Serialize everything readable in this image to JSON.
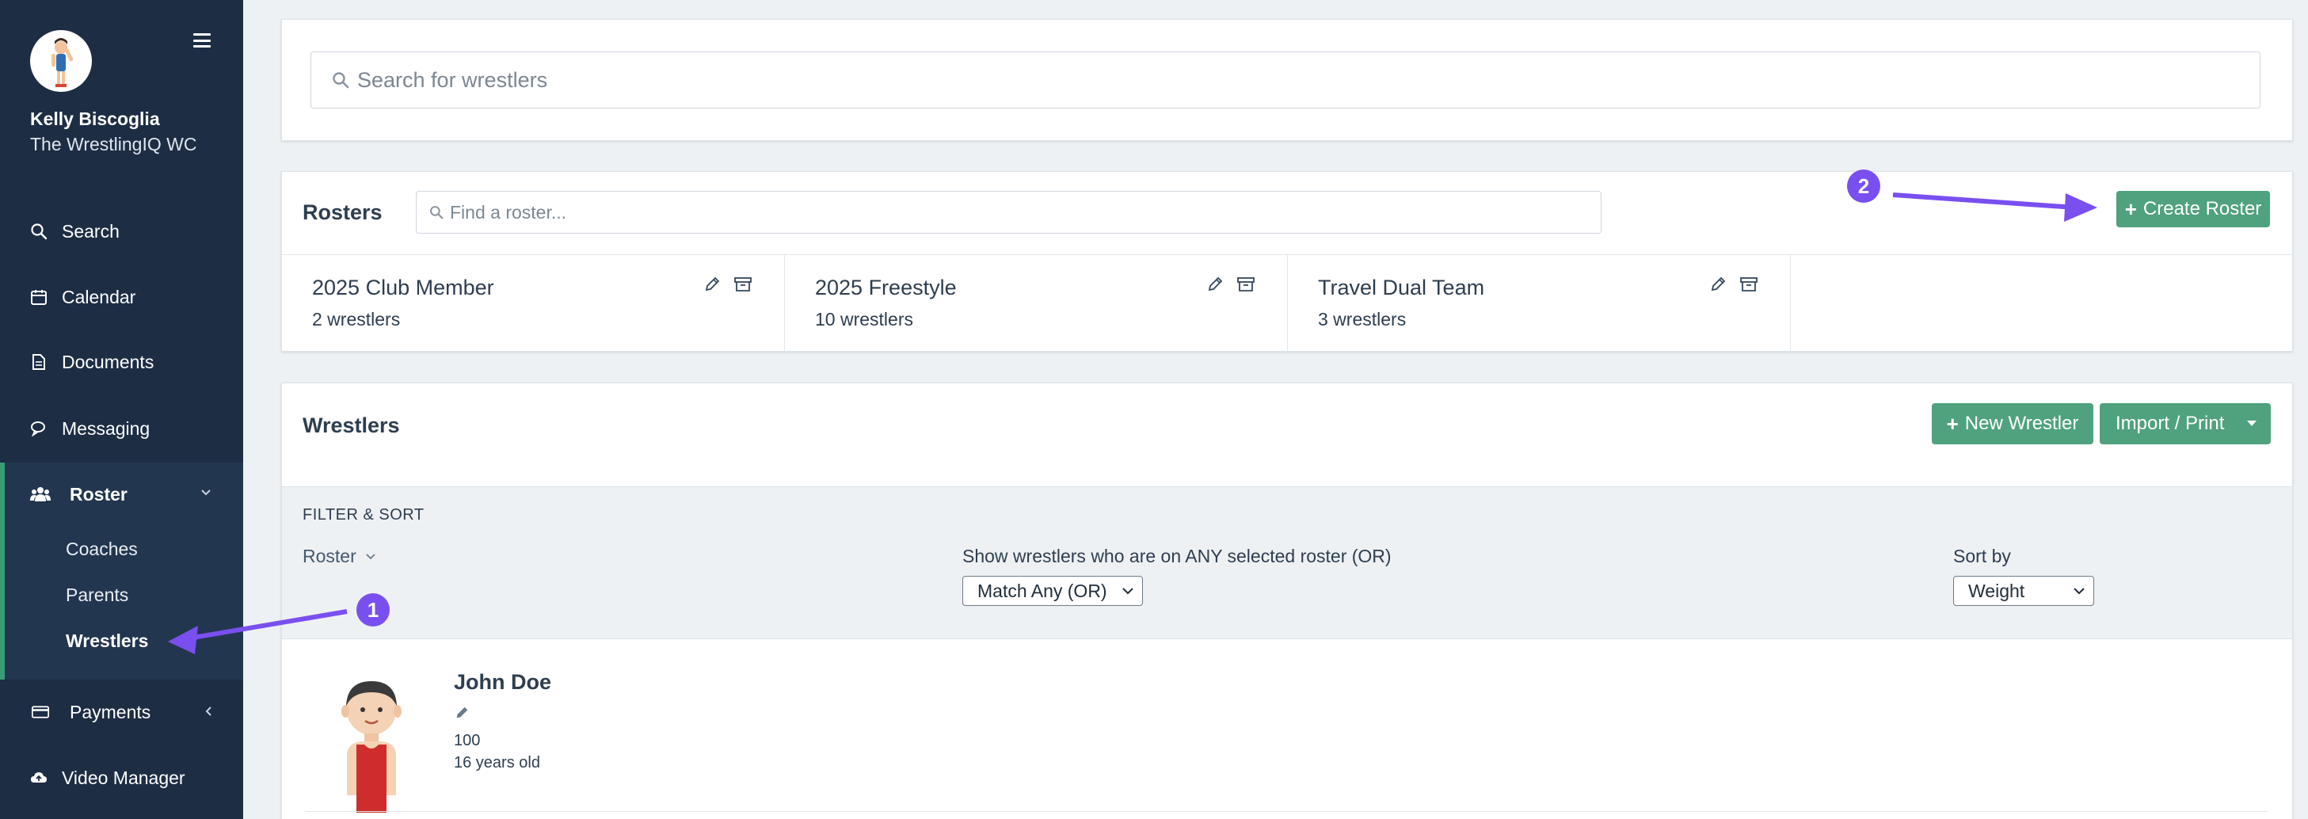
{
  "sidebar": {
    "user_name": "Kelly Biscoglia",
    "org_name": "The WrestlingIQ WC",
    "nav": [
      {
        "label": "Search",
        "icon": "search-icon"
      },
      {
        "label": "Calendar",
        "icon": "calendar-icon"
      },
      {
        "label": "Documents",
        "icon": "document-icon"
      },
      {
        "label": "Messaging",
        "icon": "chat-icon"
      },
      {
        "label": "Roster",
        "icon": "users-icon"
      },
      {
        "label": "Payments",
        "icon": "credit-card-icon"
      },
      {
        "label": "Video Manager",
        "icon": "cloud-upload-icon"
      }
    ],
    "roster_sub": [
      "Coaches",
      "Parents",
      "Wrestlers"
    ],
    "active_sub": "Wrestlers"
  },
  "search": {
    "placeholder": "Search for wrestlers"
  },
  "rosters": {
    "title": "Rosters",
    "find_placeholder": "Find a roster...",
    "create_label": "Create Roster",
    "items": [
      {
        "name": "2025 Club Member",
        "count": "2 wrestlers"
      },
      {
        "name": "2025 Freestyle",
        "count": "10 wrestlers"
      },
      {
        "name": "Travel Dual Team",
        "count": "3 wrestlers"
      }
    ]
  },
  "wrestlers": {
    "title": "Wrestlers",
    "new_label": "New Wrestler",
    "import_label": "Import / Print",
    "filter": {
      "title": "FILTER & SORT",
      "roster_label": "Roster",
      "show_label": "Show wrestlers who are on ANY selected roster (OR)",
      "match_value": "Match Any (OR)",
      "sort_label": "Sort by",
      "sort_value": "Weight"
    },
    "list": [
      {
        "name": "John Doe",
        "weight": "100",
        "age": "16 years old"
      }
    ]
  },
  "annotations": {
    "step1": "1",
    "step2": "2",
    "arrow_color": "#7a4ff0"
  },
  "colors": {
    "sidebar": "#1d2d44",
    "accent_green": "#4fa27d",
    "annotation_purple": "#7a4ff0"
  }
}
